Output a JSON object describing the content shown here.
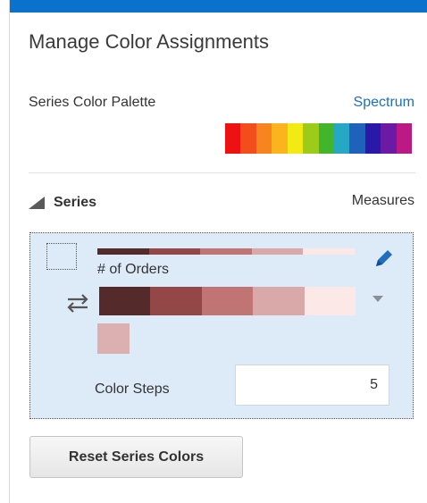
{
  "panel": {
    "title": "Manage Color Assignments",
    "accent_color": "#0a72cc"
  },
  "palette": {
    "label": "Series Color Palette",
    "name": "Spectrum",
    "colors": [
      "#ee1111",
      "#f24d1b",
      "#f7841f",
      "#fbb41e",
      "#f2ea13",
      "#9ccb19",
      "#43b52c",
      "#26a7c3",
      "#1f62bb",
      "#2a19a8",
      "#6b1aa5",
      "#bb1a86"
    ]
  },
  "series_section": {
    "toggle_icon": "triangle-collapse-icon",
    "label": "Series",
    "right_label": "Measures"
  },
  "series_item": {
    "checked": false,
    "measure_name": "# of Orders",
    "ramp_colors": [
      "#542a2a",
      "#944747",
      "#c07473",
      "#d8a9a8",
      "#fde8e8"
    ],
    "selected_color": "#dcb0b0",
    "edit_icon": "pencil-icon",
    "reverse_icon": "swap-arrows-icon",
    "dropdown_icon": "chevron-down-icon",
    "steps_label": "Color Steps",
    "steps_value": "5"
  },
  "actions": {
    "reset_label": "Reset Series Colors"
  }
}
